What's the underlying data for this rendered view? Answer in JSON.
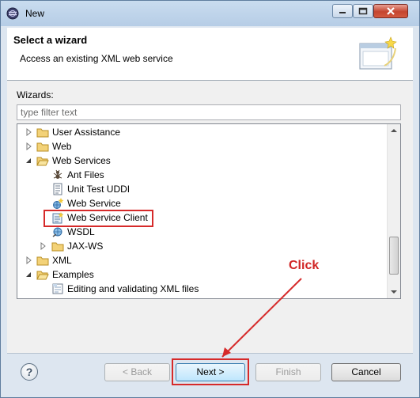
{
  "window": {
    "title": "New"
  },
  "header": {
    "title": "Select a wizard",
    "description": "Access an existing XML web service"
  },
  "filter": {
    "label": "Wizards:",
    "placeholder": "type filter text",
    "value": ""
  },
  "tree": {
    "rows": [
      {
        "label": "User Assistance",
        "level": 0,
        "expanded": false,
        "icon": "folder-icon"
      },
      {
        "label": "Web",
        "level": 0,
        "expanded": false,
        "icon": "folder-icon"
      },
      {
        "label": "Web Services",
        "level": 0,
        "expanded": true,
        "icon": "folder-open-icon"
      },
      {
        "label": "Ant Files",
        "level": 1,
        "icon": "ant-icon"
      },
      {
        "label": "Unit Test UDDI",
        "level": 1,
        "icon": "document-icon"
      },
      {
        "label": "Web Service",
        "level": 1,
        "icon": "web-service-icon"
      },
      {
        "label": "Web Service Client",
        "level": 1,
        "icon": "web-service-client-icon",
        "highlighted": true
      },
      {
        "label": "WSDL",
        "level": 1,
        "icon": "wsdl-icon"
      },
      {
        "label": "JAX-WS",
        "level": 1,
        "expanded": false,
        "icon": "folder-icon"
      },
      {
        "label": "XML",
        "level": 0,
        "expanded": false,
        "icon": "folder-icon"
      },
      {
        "label": "Examples",
        "level": 0,
        "expanded": true,
        "icon": "folder-open-icon"
      },
      {
        "label": "Editing and validating XML files",
        "level": 1,
        "icon": "example-icon"
      }
    ]
  },
  "annotation": {
    "text": "Click",
    "color": "#d12626"
  },
  "footer": {
    "help_symbol": "?",
    "back_label": "< Back",
    "next_label": "Next >",
    "finish_label": "Finish",
    "cancel_label": "Cancel"
  }
}
